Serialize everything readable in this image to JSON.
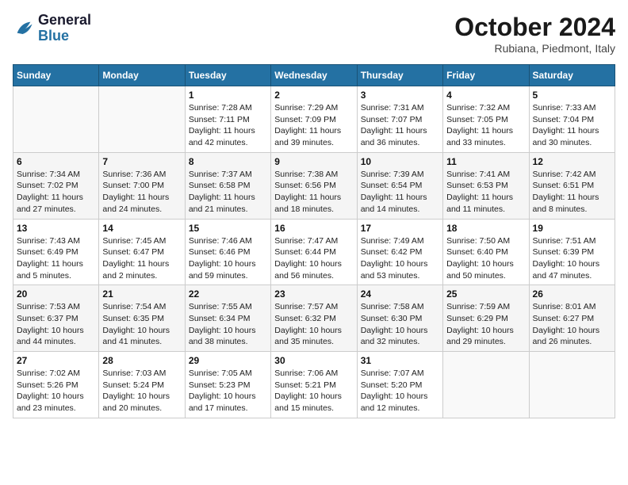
{
  "logo": {
    "line1": "General",
    "line2": "Blue"
  },
  "title": "October 2024",
  "location": "Rubiana, Piedmont, Italy",
  "days_header": [
    "Sunday",
    "Monday",
    "Tuesday",
    "Wednesday",
    "Thursday",
    "Friday",
    "Saturday"
  ],
  "weeks": [
    [
      {
        "day": "",
        "info": ""
      },
      {
        "day": "",
        "info": ""
      },
      {
        "day": "1",
        "info": "Sunrise: 7:28 AM\nSunset: 7:11 PM\nDaylight: 11 hours and 42 minutes."
      },
      {
        "day": "2",
        "info": "Sunrise: 7:29 AM\nSunset: 7:09 PM\nDaylight: 11 hours and 39 minutes."
      },
      {
        "day": "3",
        "info": "Sunrise: 7:31 AM\nSunset: 7:07 PM\nDaylight: 11 hours and 36 minutes."
      },
      {
        "day": "4",
        "info": "Sunrise: 7:32 AM\nSunset: 7:05 PM\nDaylight: 11 hours and 33 minutes."
      },
      {
        "day": "5",
        "info": "Sunrise: 7:33 AM\nSunset: 7:04 PM\nDaylight: 11 hours and 30 minutes."
      }
    ],
    [
      {
        "day": "6",
        "info": "Sunrise: 7:34 AM\nSunset: 7:02 PM\nDaylight: 11 hours and 27 minutes."
      },
      {
        "day": "7",
        "info": "Sunrise: 7:36 AM\nSunset: 7:00 PM\nDaylight: 11 hours and 24 minutes."
      },
      {
        "day": "8",
        "info": "Sunrise: 7:37 AM\nSunset: 6:58 PM\nDaylight: 11 hours and 21 minutes."
      },
      {
        "day": "9",
        "info": "Sunrise: 7:38 AM\nSunset: 6:56 PM\nDaylight: 11 hours and 18 minutes."
      },
      {
        "day": "10",
        "info": "Sunrise: 7:39 AM\nSunset: 6:54 PM\nDaylight: 11 hours and 14 minutes."
      },
      {
        "day": "11",
        "info": "Sunrise: 7:41 AM\nSunset: 6:53 PM\nDaylight: 11 hours and 11 minutes."
      },
      {
        "day": "12",
        "info": "Sunrise: 7:42 AM\nSunset: 6:51 PM\nDaylight: 11 hours and 8 minutes."
      }
    ],
    [
      {
        "day": "13",
        "info": "Sunrise: 7:43 AM\nSunset: 6:49 PM\nDaylight: 11 hours and 5 minutes."
      },
      {
        "day": "14",
        "info": "Sunrise: 7:45 AM\nSunset: 6:47 PM\nDaylight: 11 hours and 2 minutes."
      },
      {
        "day": "15",
        "info": "Sunrise: 7:46 AM\nSunset: 6:46 PM\nDaylight: 10 hours and 59 minutes."
      },
      {
        "day": "16",
        "info": "Sunrise: 7:47 AM\nSunset: 6:44 PM\nDaylight: 10 hours and 56 minutes."
      },
      {
        "day": "17",
        "info": "Sunrise: 7:49 AM\nSunset: 6:42 PM\nDaylight: 10 hours and 53 minutes."
      },
      {
        "day": "18",
        "info": "Sunrise: 7:50 AM\nSunset: 6:40 PM\nDaylight: 10 hours and 50 minutes."
      },
      {
        "day": "19",
        "info": "Sunrise: 7:51 AM\nSunset: 6:39 PM\nDaylight: 10 hours and 47 minutes."
      }
    ],
    [
      {
        "day": "20",
        "info": "Sunrise: 7:53 AM\nSunset: 6:37 PM\nDaylight: 10 hours and 44 minutes."
      },
      {
        "day": "21",
        "info": "Sunrise: 7:54 AM\nSunset: 6:35 PM\nDaylight: 10 hours and 41 minutes."
      },
      {
        "day": "22",
        "info": "Sunrise: 7:55 AM\nSunset: 6:34 PM\nDaylight: 10 hours and 38 minutes."
      },
      {
        "day": "23",
        "info": "Sunrise: 7:57 AM\nSunset: 6:32 PM\nDaylight: 10 hours and 35 minutes."
      },
      {
        "day": "24",
        "info": "Sunrise: 7:58 AM\nSunset: 6:30 PM\nDaylight: 10 hours and 32 minutes."
      },
      {
        "day": "25",
        "info": "Sunrise: 7:59 AM\nSunset: 6:29 PM\nDaylight: 10 hours and 29 minutes."
      },
      {
        "day": "26",
        "info": "Sunrise: 8:01 AM\nSunset: 6:27 PM\nDaylight: 10 hours and 26 minutes."
      }
    ],
    [
      {
        "day": "27",
        "info": "Sunrise: 7:02 AM\nSunset: 5:26 PM\nDaylight: 10 hours and 23 minutes."
      },
      {
        "day": "28",
        "info": "Sunrise: 7:03 AM\nSunset: 5:24 PM\nDaylight: 10 hours and 20 minutes."
      },
      {
        "day": "29",
        "info": "Sunrise: 7:05 AM\nSunset: 5:23 PM\nDaylight: 10 hours and 17 minutes."
      },
      {
        "day": "30",
        "info": "Sunrise: 7:06 AM\nSunset: 5:21 PM\nDaylight: 10 hours and 15 minutes."
      },
      {
        "day": "31",
        "info": "Sunrise: 7:07 AM\nSunset: 5:20 PM\nDaylight: 10 hours and 12 minutes."
      },
      {
        "day": "",
        "info": ""
      },
      {
        "day": "",
        "info": ""
      }
    ]
  ]
}
